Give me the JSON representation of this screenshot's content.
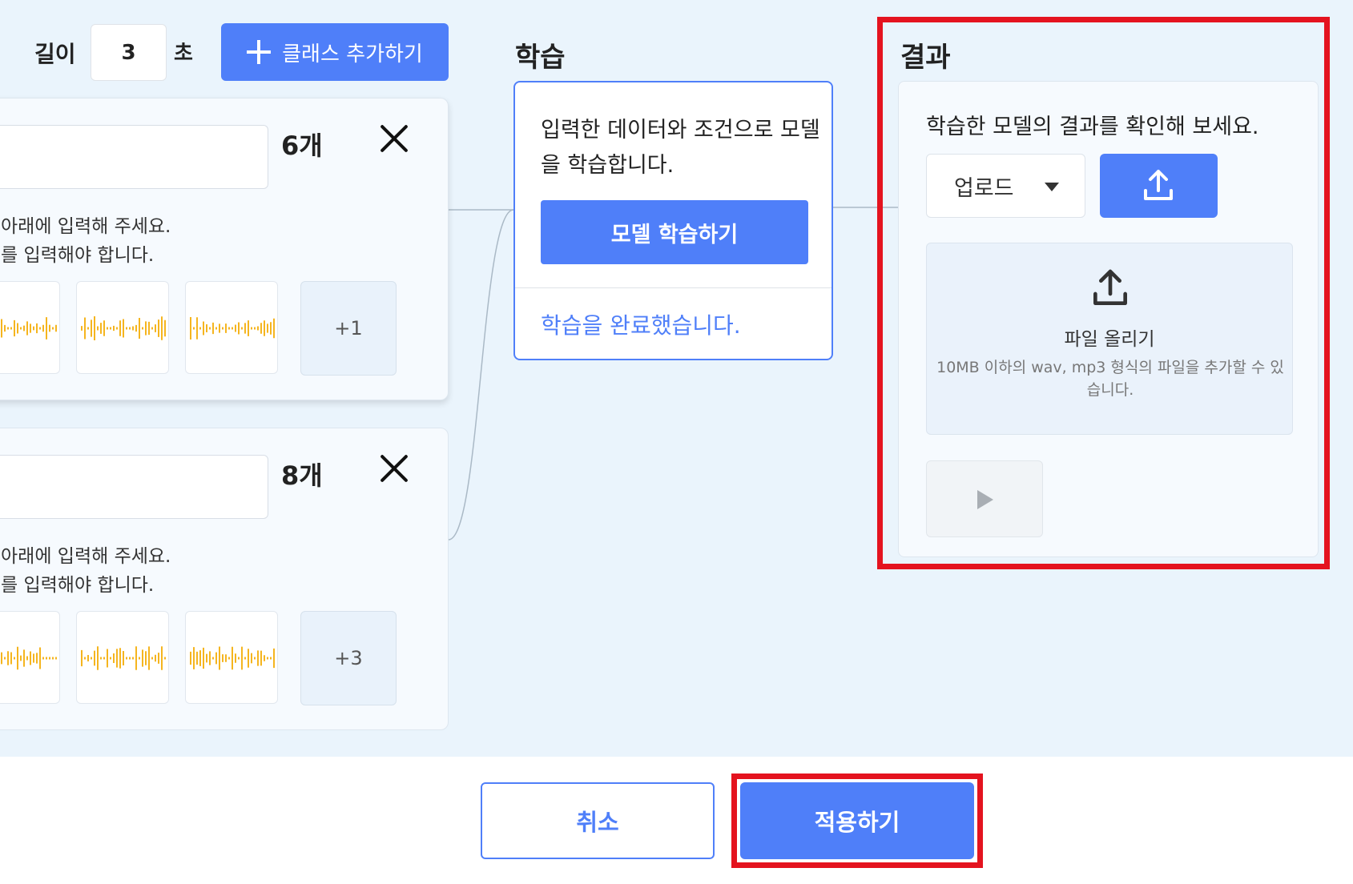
{
  "settings": {
    "length_label": "길이",
    "length_value": "3",
    "unit_label": "초",
    "add_class_label": "클래스 추가하기"
  },
  "classes": [
    {
      "count": "6개",
      "desc_line1": "아래에 입력해 주세요.",
      "desc_line2": "를 입력해야 합니다.",
      "more": "+1"
    },
    {
      "count": "8개",
      "desc_line1": "아래에 입력해 주세요.",
      "desc_line2": "를 입력해야 합니다.",
      "more": "+3"
    }
  ],
  "training": {
    "title": "학습",
    "description": "입력한 데이터와 조건으로 모델을 학습합니다.",
    "train_button": "모델 학습하기",
    "status": "학습을 완료했습니다."
  },
  "result": {
    "title": "결과",
    "description": "학습한 모델의 결과를 확인해 보세요.",
    "source_select": "업로드",
    "dropzone_title": "파일 올리기",
    "dropzone_help": "10MB 이하의 wav, mp3 형식의 파일을 추가할 수 있습니다."
  },
  "footer": {
    "cancel_label": "취소",
    "apply_label": "적용하기"
  },
  "colors": {
    "accent": "#4f7ff9",
    "highlight": "#e4131f",
    "waveform": "#f5b51f",
    "workspace_bg": "#eaf4fc"
  },
  "icons": {
    "add": "plus-icon",
    "remove": "close-icon",
    "dropdown": "caret-down-icon",
    "upload": "upload-icon",
    "play": "play-icon",
    "sample": "waveform-icon"
  }
}
